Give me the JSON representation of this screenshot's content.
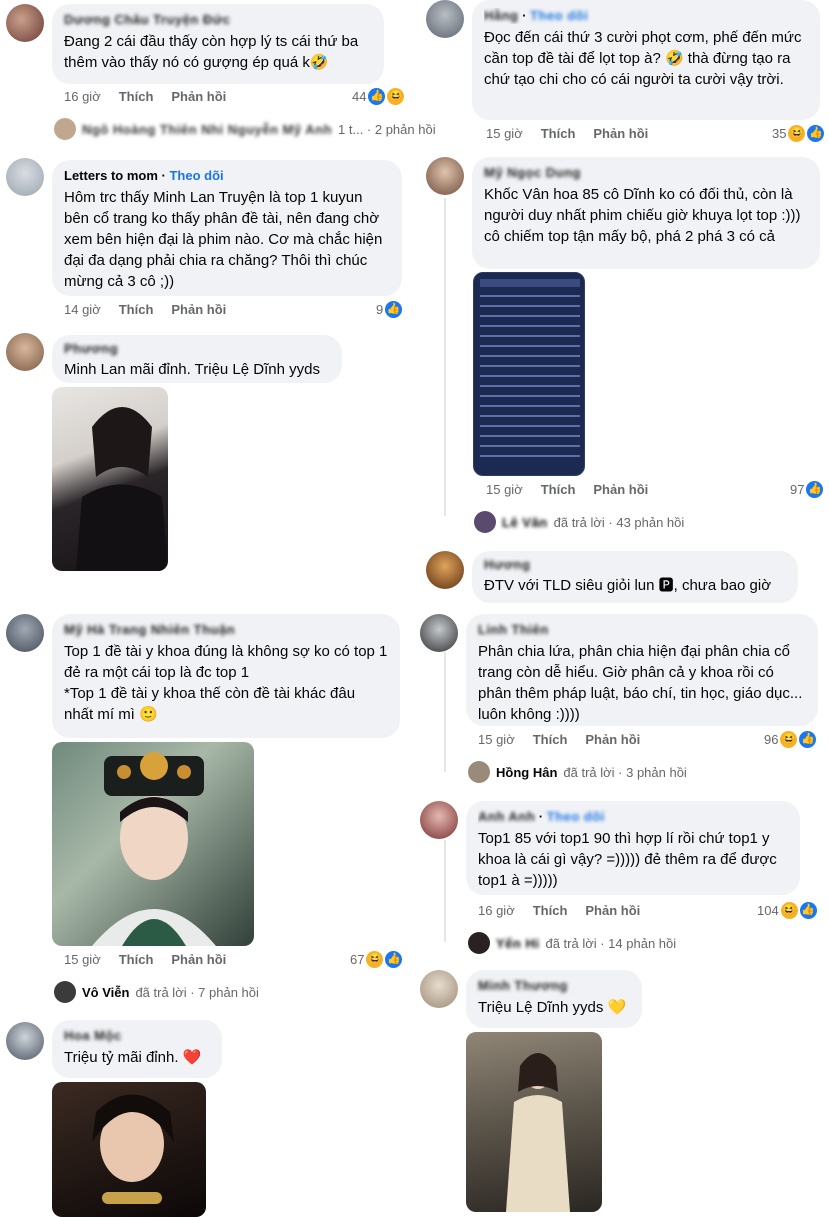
{
  "left": [
    {
      "author": "Dương Châu Truyện Đức",
      "text": "Đang 2 cái đầu thấy còn hợp lý ts cái thứ ba thêm vào thấy nó có gượng ép quá k🤣",
      "time": "16 giờ",
      "like": "Thích",
      "reply": "Phản hồi",
      "count": "44",
      "reply_summary": "1 t... · 2 phản hồi"
    },
    {
      "author": "Letters to mom",
      "follow": "Theo dõi",
      "text": "Hôm trc thấy Minh Lan Truyện là top 1 kuyun bên cổ trang ko thấy phân đề tài, nên đang chờ xem bên hiện đại là phim nào. Cơ mà chắc hiện đại đa dạng phải chia ra chăng? Thôi thì chúc mừng cả 3 cô ;))",
      "time": "14 giờ",
      "like": "Thích",
      "reply": "Phản hồi",
      "count": "9"
    },
    {
      "author": "Phương",
      "text": "Minh Lan mãi đỉnh. Triệu Lệ Dĩnh yyds"
    },
    {
      "author": "Mỹ Hà Trang Nhiên Thuận",
      "text": "Top 1 đề tài y khoa đúng là không sợ ko có top 1 đẻ ra một cái top là đc top 1\n*Top 1 đề tài y khoa thế còn đề tài khác đâu nhất mí mì 🙂",
      "time": "15 giờ",
      "like": "Thích",
      "reply": "Phản hồi",
      "count": "67",
      "reply_name": "Vô Viễn",
      "reply_summary": "đã trả lời · 7 phản hồi"
    },
    {
      "author": "Hoa Mộc",
      "text": "Triệu tỷ mãi đỉnh. ❤️"
    }
  ],
  "right": [
    {
      "author": "Hằng",
      "follow": "Theo dõi",
      "text": "Đọc đến cái thứ 3 cười phọt cơm, phế đến mức cần top đề tài để lọt top à? 🤣 thà đừng tạo ra chứ tạo chi cho có cái người ta cười vậy trời.",
      "time": "15 giờ",
      "like": "Thích",
      "reply": "Phản hồi",
      "count": "35"
    },
    {
      "author": "Mỹ Ngọc Dung",
      "text": "Khốc Vân hoa 85 cô Dĩnh ko có đối thủ, còn là người duy nhất phim chiếu giờ khuya lọt top :))) cô chiếm top tận mấy bộ, phá 2 phá 3 có cả",
      "time": "15 giờ",
      "like": "Thích",
      "reply": "Phản hồi",
      "count": "97",
      "reply_name": "Lê Văn",
      "reply_summary": "đã trả lời · 43 phản hồi"
    },
    {
      "author": "Hương",
      "text": "ĐTV với TLD siêu giỏi lun 🅿, chưa bao giờ"
    },
    {
      "author": "Linh Thiên",
      "text": "Phân chia lứa, phân chia hiện đại phân chia cổ trang còn dễ hiểu. Giờ phân cả y khoa rồi có phân thêm pháp luật, báo chí, tin học, giáo dục... luôn không :))))",
      "time": "15 giờ",
      "like": "Thích",
      "reply": "Phản hồi",
      "count": "96",
      "reply_name": "Hồng Hân",
      "reply_summary": "đã trả lời · 3 phản hồi"
    },
    {
      "author": "Anh Anh",
      "follow": "Theo dõi",
      "text": "Top1 85 với top1 90 thì hợp lí rồi chứ top1 y khoa là cái gì vậy? =))))) đẻ thêm ra để được top1 à =)))))",
      "time": "16 giờ",
      "like": "Thích",
      "reply": "Phản hồi",
      "count": "104",
      "reply_name": "Yến Hi",
      "reply_summary": "đã trả lời · 14 phản hồi"
    },
    {
      "author": "Minh Thương",
      "text": "Triệu Lệ Dĩnh yyds 💛"
    }
  ],
  "colors": {
    "bubble": "#f0f2f5",
    "meta": "#65676b",
    "link": "#1b74e4",
    "like": "#1877f2",
    "haha": "#f7b125"
  }
}
